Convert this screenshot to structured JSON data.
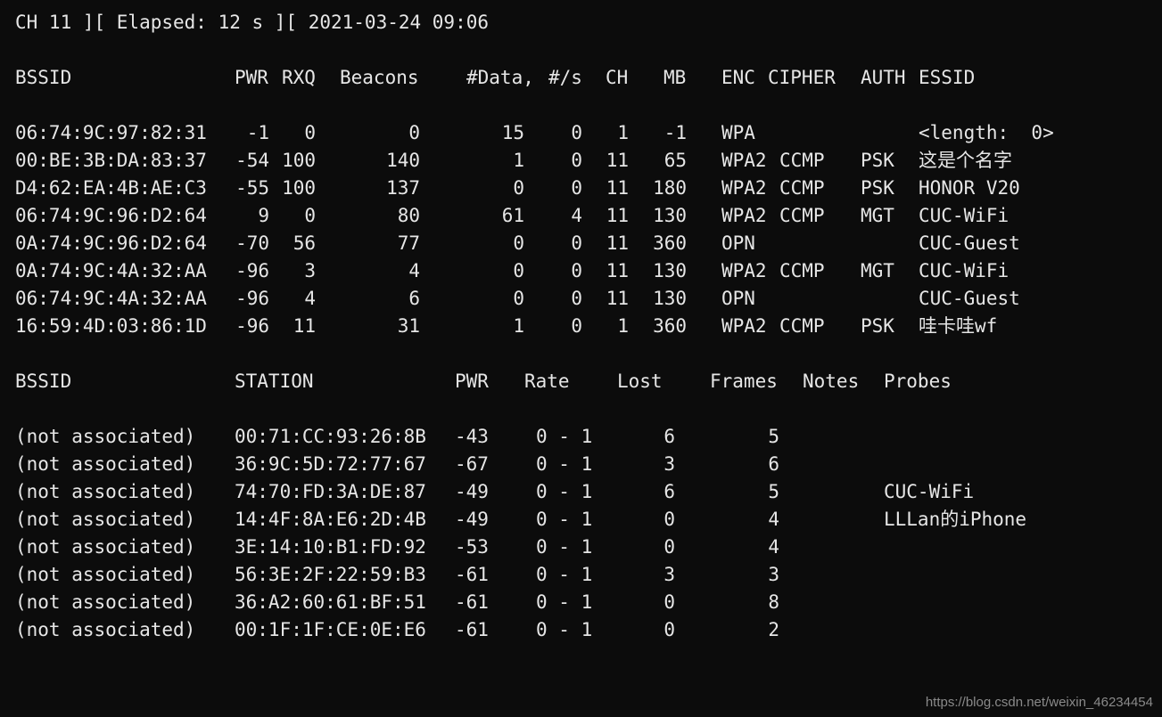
{
  "status_line": "CH 11 ][ Elapsed: 12 s ][ 2021-03-24 09:06",
  "ap_header": {
    "bssid": "BSSID",
    "pwr": "PWR",
    "rxq": "RXQ",
    "beacons": "Beacons",
    "data": "#Data,",
    "per_s": "#/s",
    "ch": "CH",
    "mb": "MB",
    "enc": "ENC",
    "cipher": "CIPHER",
    "auth": "AUTH",
    "essid": "ESSID"
  },
  "ap_rows": [
    {
      "bssid": "06:74:9C:97:82:31",
      "pwr": "-1",
      "rxq": "0",
      "beacons": "0",
      "data": "15",
      "per_s": "0",
      "ch": "1",
      "mb": "-1",
      "enc": "WPA",
      "cipher": "",
      "auth": "",
      "essid": "<length:  0>"
    },
    {
      "bssid": "00:BE:3B:DA:83:37",
      "pwr": "-54",
      "rxq": "100",
      "beacons": "140",
      "data": "1",
      "per_s": "0",
      "ch": "11",
      "mb": "65",
      "enc": "WPA2",
      "cipher": "CCMP",
      "auth": "PSK",
      "essid": "这是个名字"
    },
    {
      "bssid": "D4:62:EA:4B:AE:C3",
      "pwr": "-55",
      "rxq": "100",
      "beacons": "137",
      "data": "0",
      "per_s": "0",
      "ch": "11",
      "mb": "180",
      "enc": "WPA2",
      "cipher": "CCMP",
      "auth": "PSK",
      "essid": "HONOR V20"
    },
    {
      "bssid": "06:74:9C:96:D2:64",
      "pwr": "9",
      "rxq": "0",
      "beacons": "80",
      "data": "61",
      "per_s": "4",
      "ch": "11",
      "mb": "130",
      "enc": "WPA2",
      "cipher": "CCMP",
      "auth": "MGT",
      "essid": "CUC-WiFi"
    },
    {
      "bssid": "0A:74:9C:96:D2:64",
      "pwr": "-70",
      "rxq": "56",
      "beacons": "77",
      "data": "0",
      "per_s": "0",
      "ch": "11",
      "mb": "360",
      "enc": "OPN",
      "cipher": "",
      "auth": "",
      "essid": "CUC-Guest"
    },
    {
      "bssid": "0A:74:9C:4A:32:AA",
      "pwr": "-96",
      "rxq": "3",
      "beacons": "4",
      "data": "0",
      "per_s": "0",
      "ch": "11",
      "mb": "130",
      "enc": "WPA2",
      "cipher": "CCMP",
      "auth": "MGT",
      "essid": "CUC-WiFi"
    },
    {
      "bssid": "06:74:9C:4A:32:AA",
      "pwr": "-96",
      "rxq": "4",
      "beacons": "6",
      "data": "0",
      "per_s": "0",
      "ch": "11",
      "mb": "130",
      "enc": "OPN",
      "cipher": "",
      "auth": "",
      "essid": "CUC-Guest"
    },
    {
      "bssid": "16:59:4D:03:86:1D",
      "pwr": "-96",
      "rxq": "11",
      "beacons": "31",
      "data": "1",
      "per_s": "0",
      "ch": "1",
      "mb": "360",
      "enc": "WPA2",
      "cipher": "CCMP",
      "auth": "PSK",
      "essid": "哇卡哇wf"
    }
  ],
  "sta_header": {
    "bssid": "BSSID",
    "station": "STATION",
    "pwr": "PWR",
    "rate": "Rate",
    "lost": "Lost",
    "frames": "Frames",
    "notes": "Notes",
    "probes": "Probes"
  },
  "sta_rows": [
    {
      "bssid": "(not associated)",
      "station": "00:71:CC:93:26:8B",
      "pwr": "-43",
      "rate": "0 - 1",
      "lost": "6",
      "frames": "5",
      "notes": "",
      "probes": ""
    },
    {
      "bssid": "(not associated)",
      "station": "36:9C:5D:72:77:67",
      "pwr": "-67",
      "rate": "0 - 1",
      "lost": "3",
      "frames": "6",
      "notes": "",
      "probes": ""
    },
    {
      "bssid": "(not associated)",
      "station": "74:70:FD:3A:DE:87",
      "pwr": "-49",
      "rate": "0 - 1",
      "lost": "6",
      "frames": "5",
      "notes": "",
      "probes": "CUC-WiFi"
    },
    {
      "bssid": "(not associated)",
      "station": "14:4F:8A:E6:2D:4B",
      "pwr": "-49",
      "rate": "0 - 1",
      "lost": "0",
      "frames": "4",
      "notes": "",
      "probes": "LLLan的iPhone"
    },
    {
      "bssid": "(not associated)",
      "station": "3E:14:10:B1:FD:92",
      "pwr": "-53",
      "rate": "0 - 1",
      "lost": "0",
      "frames": "4",
      "notes": "",
      "probes": ""
    },
    {
      "bssid": "(not associated)",
      "station": "56:3E:2F:22:59:B3",
      "pwr": "-61",
      "rate": "0 - 1",
      "lost": "3",
      "frames": "3",
      "notes": "",
      "probes": ""
    },
    {
      "bssid": "(not associated)",
      "station": "36:A2:60:61:BF:51",
      "pwr": "-61",
      "rate": "0 - 1",
      "lost": "0",
      "frames": "8",
      "notes": "",
      "probes": ""
    },
    {
      "bssid": "(not associated)",
      "station": "00:1F:1F:CE:0E:E6",
      "pwr": "-61",
      "rate": "0 - 1",
      "lost": "0",
      "frames": "2",
      "notes": "",
      "probes": ""
    }
  ],
  "watermark": "https://blog.csdn.net/weixin_46234454",
  "colors": {
    "background": "#0c0c0c",
    "text": "#e6e6e6"
  }
}
